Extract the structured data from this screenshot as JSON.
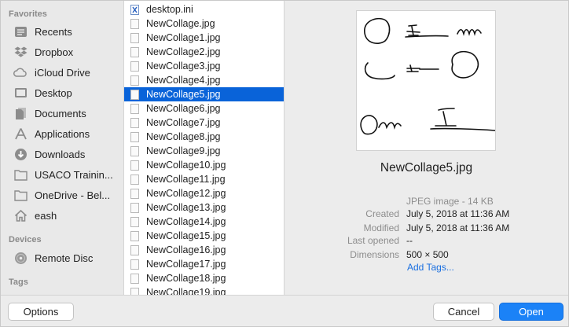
{
  "sidebar": {
    "favorites_header": "Favorites",
    "favorites": [
      {
        "label": "Recents",
        "icon": "recents-icon"
      },
      {
        "label": "Dropbox",
        "icon": "dropbox-icon"
      },
      {
        "label": "iCloud Drive",
        "icon": "icloud-icon"
      },
      {
        "label": "Desktop",
        "icon": "desktop-icon"
      },
      {
        "label": "Documents",
        "icon": "documents-icon"
      },
      {
        "label": "Applications",
        "icon": "applications-icon"
      },
      {
        "label": "Downloads",
        "icon": "downloads-icon"
      },
      {
        "label": "USACO Trainin...",
        "icon": "folder-icon"
      },
      {
        "label": "OneDrive - Bel...",
        "icon": "folder-icon"
      },
      {
        "label": "eash",
        "icon": "home-icon"
      }
    ],
    "devices_header": "Devices",
    "devices": [
      {
        "label": "Remote Disc",
        "icon": "disc-icon"
      }
    ],
    "tags_header": "Tags"
  },
  "files": [
    "desktop.ini",
    "NewCollage.jpg",
    "NewCollage1.jpg",
    "NewCollage2.jpg",
    "NewCollage3.jpg",
    "NewCollage4.jpg",
    "NewCollage5.jpg",
    "NewCollage6.jpg",
    "NewCollage7.jpg",
    "NewCollage8.jpg",
    "NewCollage9.jpg",
    "NewCollage10.jpg",
    "NewCollage11.jpg",
    "NewCollage12.jpg",
    "NewCollage13.jpg",
    "NewCollage14.jpg",
    "NewCollage15.jpg",
    "NewCollage16.jpg",
    "NewCollage17.jpg",
    "NewCollage18.jpg",
    "NewCollage19.jpg"
  ],
  "selected_file": "NewCollage5.jpg",
  "preview": {
    "title": "NewCollage5.jpg",
    "kind": "JPEG image - 14 KB",
    "created_label": "Created",
    "created": "July 5, 2018 at 11:36 AM",
    "modified_label": "Modified",
    "modified": "July 5, 2018 at 11:36 AM",
    "last_opened_label": "Last opened",
    "last_opened": "--",
    "dimensions_label": "Dimensions",
    "dimensions": "500 × 500",
    "add_tags": "Add Tags..."
  },
  "footer": {
    "options_label": "Options",
    "cancel_label": "Cancel",
    "open_label": "Open"
  },
  "colors": {
    "selection": "#0963d9",
    "primary_button": "#1b82f7",
    "link": "#1a6fe0"
  }
}
